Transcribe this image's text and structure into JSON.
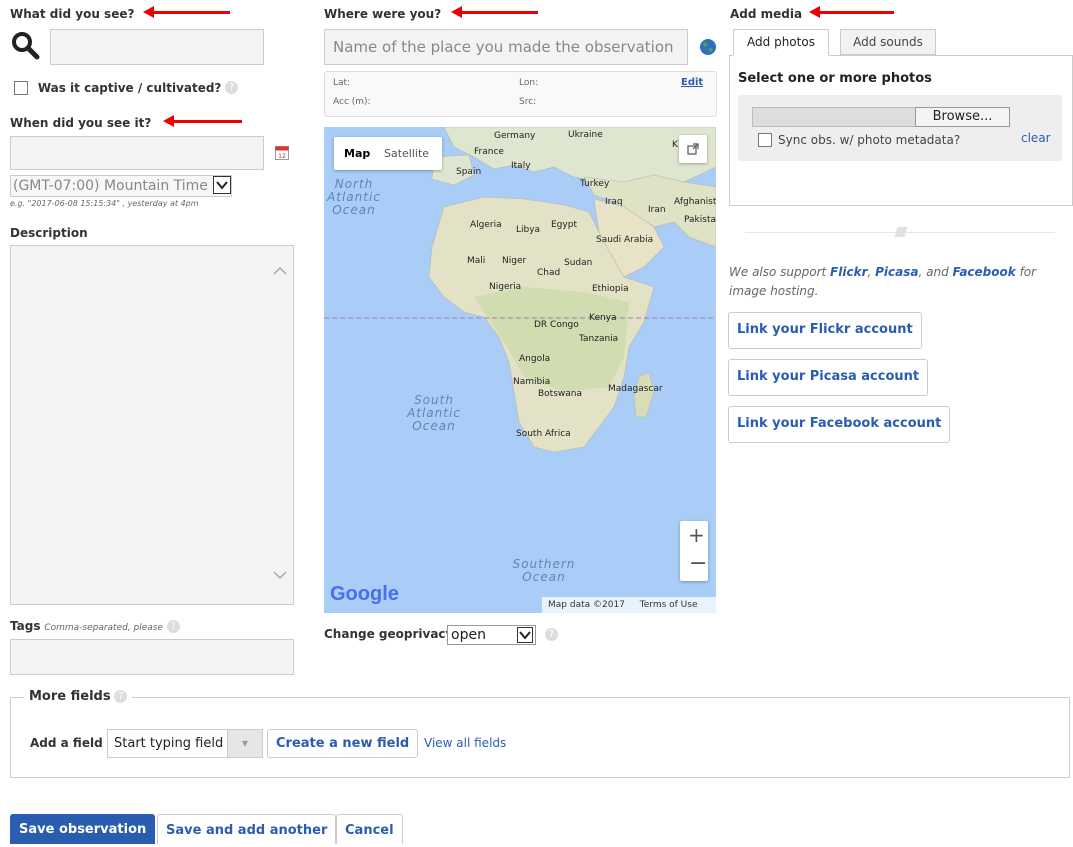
{
  "left": {
    "what_label": "What did you see?",
    "captive_label": "Was it captive / cultivated?",
    "when_label": "When did you see it?",
    "timezone_value": "(GMT-07:00) Mountain Time (",
    "date_example": "e.g. \"2017-06-08 15:15:34\" , yesterday at 4pm",
    "description_label": "Description",
    "tags_label": "Tags",
    "tags_hint": "Comma-separated, please"
  },
  "middle": {
    "where_label": "Where were you?",
    "place_placeholder": "Name of the place you made the observation",
    "lat_label": "Lat:",
    "lon_label": "Lon:",
    "edit_link": "Edit",
    "acc_label": "Acc (m):",
    "src_label": "Src:",
    "map_tab_map": "Map",
    "map_tab_satellite": "Satellite",
    "map_data": "Map data ©2017",
    "terms": "Terms of Use",
    "google": "Google",
    "geoprivacy_label": "Change geoprivacy",
    "geoprivacy_value": "open",
    "map_labels": {
      "north_atlantic": [
        "North",
        "Atlantic",
        "Ocean"
      ],
      "south_atlantic": [
        "South",
        "Atlantic",
        "Ocean"
      ],
      "southern_ocean": [
        "Southern",
        "Ocean"
      ],
      "germany": "Germany",
      "ukraine": "Ukraine",
      "france": "France",
      "italy": "Italy",
      "spain": "Spain",
      "turkey": "Turkey",
      "iraq": "Iraq",
      "iran": "Iran",
      "afghanistan": "Afghanist",
      "pakistan": "Pakistan",
      "algeria": "Algeria",
      "libya": "Libya",
      "egypt": "Egypt",
      "saudi": "Saudi Arabia",
      "mali": "Mali",
      "niger": "Niger",
      "chad": "Chad",
      "sudan": "Sudan",
      "nigeria": "Nigeria",
      "ethiopia": "Ethiopia",
      "kenya": "Kenya",
      "drc": "DR Congo",
      "tanzania": "Tanzania",
      "angola": "Angola",
      "namibia": "Namibia",
      "botswana": "Botswana",
      "madagascar": "Madagascar",
      "south_africa": "South Africa",
      "k": "K"
    }
  },
  "right": {
    "media_label": "Add media",
    "tab_photos": "Add photos",
    "tab_sounds": "Add sounds",
    "select_photos": "Select one or more photos",
    "browse": "Browse...",
    "sync_label": "Sync obs. w/ photo metadata?",
    "clear": "clear",
    "support_pre": "We also support ",
    "flickr": "Flickr",
    "comma1": ", ",
    "picasa": "Picasa",
    "and": ", and ",
    "facebook": "Facebook",
    "support_post": " for image hosting.",
    "link_flickr": "Link your Flickr account",
    "link_picasa": "Link your Picasa account",
    "link_facebook": "Link your Facebook account"
  },
  "more": {
    "legend": "More fields",
    "add_field_label": "Add a field",
    "field_placeholder": "Start typing field",
    "create_field": "Create a new field",
    "view_all": "View all fields"
  },
  "actions": {
    "save": "Save observation",
    "save_another": "Save and add another",
    "cancel": "Cancel"
  }
}
